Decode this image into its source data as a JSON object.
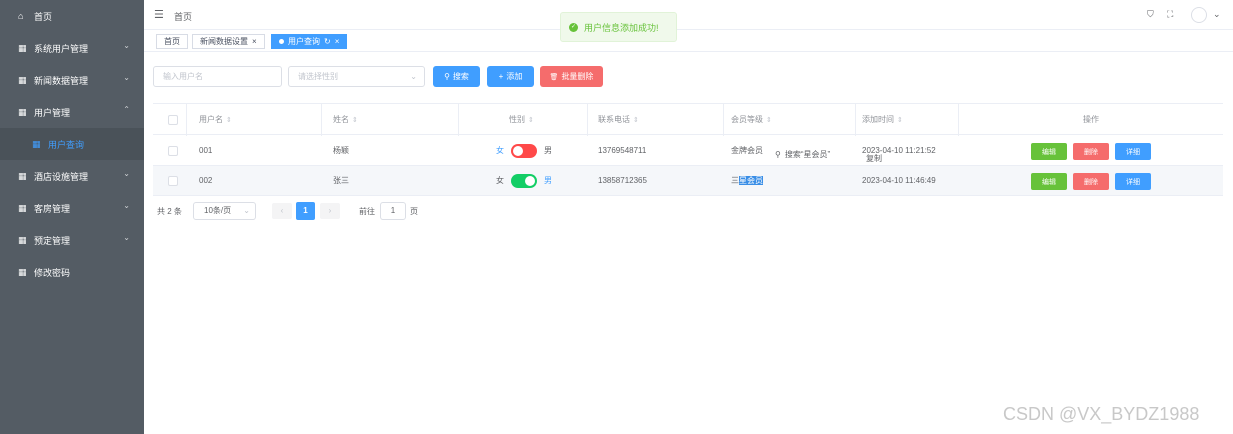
{
  "sidebar": {
    "items": [
      {
        "icon": "home-icon",
        "glyph": "⌂",
        "label": "首页",
        "chevron": ""
      },
      {
        "icon": "grid-icon",
        "glyph": "▦",
        "label": "系统用户管理",
        "chevron": "⌄"
      },
      {
        "icon": "grid-icon",
        "glyph": "▦",
        "label": "新闻数据管理",
        "chevron": "⌄"
      },
      {
        "icon": "grid-icon",
        "glyph": "▦",
        "label": "用户管理",
        "chevron": "⌃"
      },
      {
        "icon": "grid-icon",
        "glyph": "▦",
        "label": "用户查询",
        "chevron": ""
      },
      {
        "icon": "grid-icon",
        "glyph": "▦",
        "label": "酒店设施管理",
        "chevron": "⌄"
      },
      {
        "icon": "grid-icon",
        "glyph": "▦",
        "label": "客房管理",
        "chevron": "⌄"
      },
      {
        "icon": "grid-icon",
        "glyph": "▦",
        "label": "预定管理",
        "chevron": "⌄"
      },
      {
        "icon": "grid-icon",
        "glyph": "▦",
        "label": "修改密码",
        "chevron": ""
      }
    ]
  },
  "header": {
    "hamburger": "☰",
    "breadcrumb": "首页",
    "icons": {
      "shirt": "⛉",
      "fullscreen": "⛶",
      "dropdown": "⌄"
    }
  },
  "tabs": [
    {
      "label": "首页",
      "close": ""
    },
    {
      "label": "新闻数据设置",
      "close": "×"
    },
    {
      "label": "用户查询",
      "close": "×",
      "refresh": "↻"
    }
  ],
  "toast": {
    "icon": "✓",
    "text": "用户信息添加成功!"
  },
  "filters": {
    "username_placeholder": "输入用户名",
    "gender_placeholder": "请选择性别",
    "arrow": "⌄",
    "search_label": "搜索",
    "search_icon": "⚲",
    "add_label": "添加",
    "add_icon": "+",
    "batch_delete_label": "批量删除",
    "batch_delete_icon": "🗑"
  },
  "table": {
    "columns": [
      "用户名",
      "姓名",
      "性别",
      "联系电话",
      "会员等级",
      "添加时间",
      "操作"
    ],
    "sort_icon": "⇕",
    "rows": [
      {
        "username": "001",
        "name": "杨颖",
        "gender_female": "女",
        "gender_male": "男",
        "phone": "13769548711",
        "level": "金牌会员",
        "time": "2023-04-10 11:21:52"
      },
      {
        "username": "002",
        "name": "张三",
        "gender_female": "女",
        "gender_male": "男",
        "phone": "13858712365",
        "level_pre": "三",
        "level": "星会员",
        "time": "2023-04-10 11:46:49"
      }
    ],
    "actions": {
      "edit": "编辑",
      "delete": "删除",
      "detail": "详细"
    }
  },
  "popup": {
    "icon": "⚲",
    "search_text": "搜索“星会员”",
    "copy_text": "复制"
  },
  "pagination": {
    "total": "共 2 条",
    "page_size": "10条/页",
    "prev": "‹",
    "current": "1",
    "next": "›",
    "goto_label": "前往",
    "goto_value": "1",
    "page_label": "页"
  },
  "colors": {
    "sidebar": "#545c64",
    "primary": "#409eff",
    "danger": "#f56c6c",
    "success": "#67c23a"
  },
  "watermark": "CSDN @VX_BYDZ1988"
}
